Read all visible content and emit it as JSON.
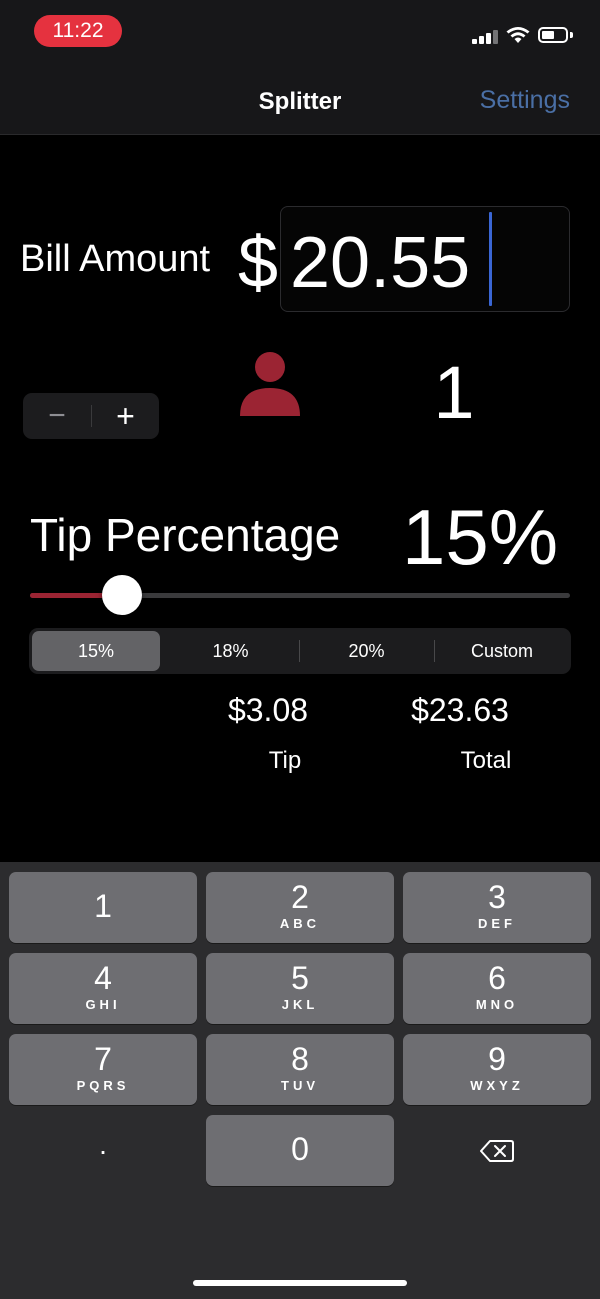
{
  "status": {
    "time": "11:22",
    "time_pill_color": "#e5323f"
  },
  "nav": {
    "title": "Splitter",
    "settings_label": "Settings",
    "settings_color": "#4a6fa5"
  },
  "bill": {
    "label": "Bill Amount",
    "currency": "$",
    "value": "20.55"
  },
  "party": {
    "minus": "−",
    "plus": "+",
    "count": "1",
    "icon": "person-icon",
    "icon_color": "#9b2433"
  },
  "tip": {
    "label": "Tip Percentage",
    "value": "15%",
    "slider_fraction": 0.17,
    "slider_color": "#9b2433",
    "options": [
      "15%",
      "18%",
      "20%",
      "Custom"
    ],
    "selected_index": 0
  },
  "results": {
    "tip_amount": "$3.08",
    "tip_caption": "Tip",
    "total_amount": "$23.63",
    "total_caption": "Total"
  },
  "keypad": {
    "keys": [
      {
        "digit": "1",
        "letters": ""
      },
      {
        "digit": "2",
        "letters": "ABC"
      },
      {
        "digit": "3",
        "letters": "DEF"
      },
      {
        "digit": "4",
        "letters": "GHI"
      },
      {
        "digit": "5",
        "letters": "JKL"
      },
      {
        "digit": "6",
        "letters": "MNO"
      },
      {
        "digit": "7",
        "letters": "PQRS"
      },
      {
        "digit": "8",
        "letters": "TUV"
      },
      {
        "digit": "9",
        "letters": "WXYZ"
      },
      {
        "digit": ".",
        "letters": ""
      },
      {
        "digit": "0",
        "letters": ""
      },
      {
        "digit": "",
        "letters": "",
        "icon": "backspace-icon"
      }
    ]
  }
}
